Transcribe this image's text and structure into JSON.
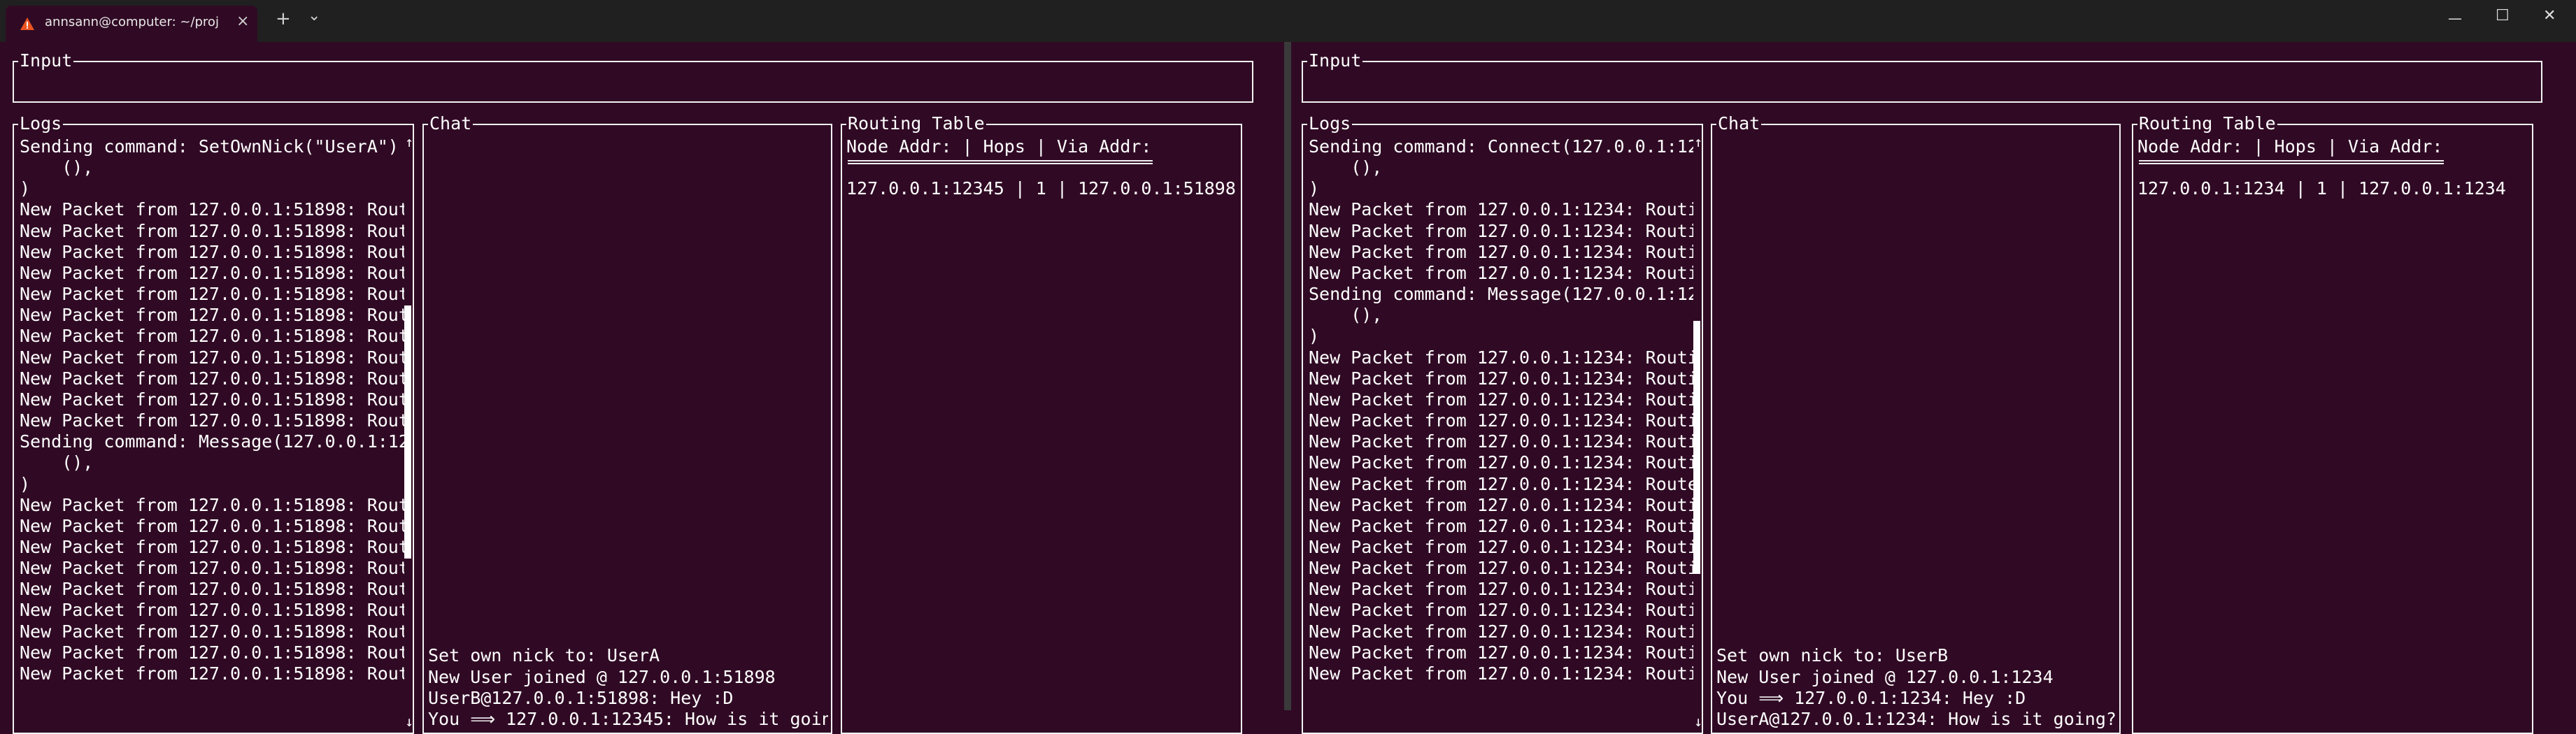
{
  "window": {
    "tab_title": "annsann@computer: ~/project",
    "new_tab_symbol": "+",
    "dropdown_symbol": "⌄",
    "close_symbol": "×",
    "minimize_symbol": "—",
    "maximize_symbol": "☐",
    "window_close_symbol": "✕",
    "accent_color": "#e95420"
  },
  "left": {
    "input_title": "Input",
    "logs_title": "Logs",
    "logs_lines": "Sending command: SetOwnNick(\"UserA\")\n    (),\n)\nNew Packet from 127.0.0.1:51898: Rout\nNew Packet from 127.0.0.1:51898: Rout\nNew Packet from 127.0.0.1:51898: Rout\nNew Packet from 127.0.0.1:51898: Rout\nNew Packet from 127.0.0.1:51898: Rout\nNew Packet from 127.0.0.1:51898: Rout\nNew Packet from 127.0.0.1:51898: Rout\nNew Packet from 127.0.0.1:51898: Rout\nNew Packet from 127.0.0.1:51898: Rout\nNew Packet from 127.0.0.1:51898: Rout\nNew Packet from 127.0.0.1:51898: Rout\nSending command: Message(127.0.0.1:12\n    (),\n)\nNew Packet from 127.0.0.1:51898: Rout\nNew Packet from 127.0.0.1:51898: Rout\nNew Packet from 127.0.0.1:51898: Rout\nNew Packet from 127.0.0.1:51898: Rout\nNew Packet from 127.0.0.1:51898: Rout\nNew Packet from 127.0.0.1:51898: Rout\nNew Packet from 127.0.0.1:51898: Rout\nNew Packet from 127.0.0.1:51898: Rout\nNew Packet from 127.0.0.1:51898: Rout",
    "scroll_position": 0.5,
    "chat_title": "Chat",
    "chat_lines": "Set own nick to: UserA\nNew User joined @ 127.0.0.1:51898\nUserB@127.0.0.1:51898: Hey :D\nYou ⟹ 127.0.0.1:12345: How is it goin",
    "routing_title": "Routing Table",
    "routing_header": "Node Addr: | Hops | Via Addr:",
    "routing_rows": "127.0.0.1:12345 | 1 | 127.0.0.1:51898"
  },
  "right": {
    "input_title": "Input",
    "logs_title": "Logs",
    "logs_lines": "Sending command: Connect(127.0.0.1:12\n    (),\n)\nNew Packet from 127.0.0.1:1234: Routi\nNew Packet from 127.0.0.1:1234: Routi\nNew Packet from 127.0.0.1:1234: Routi\nNew Packet from 127.0.0.1:1234: Routi\nSending command: Message(127.0.0.1:12\n    (),\n)\nNew Packet from 127.0.0.1:1234: Routi\nNew Packet from 127.0.0.1:1234: Routi\nNew Packet from 127.0.0.1:1234: Routi\nNew Packet from 127.0.0.1:1234: Routi\nNew Packet from 127.0.0.1:1234: Routi\nNew Packet from 127.0.0.1:1234: Routi\nNew Packet from 127.0.0.1:1234: Route\nNew Packet from 127.0.0.1:1234: Routi\nNew Packet from 127.0.0.1:1234: Routi\nNew Packet from 127.0.0.1:1234: Routi\nNew Packet from 127.0.0.1:1234: Routi\nNew Packet from 127.0.0.1:1234: Routi\nNew Packet from 127.0.0.1:1234: Routi\nNew Packet from 127.0.0.1:1234: Routi\nNew Packet from 127.0.0.1:1234: Routi\nNew Packet from 127.0.0.1:1234: Routi",
    "scroll_position": 0.55,
    "chat_title": "Chat",
    "chat_lines": "Set own nick to: UserB\nNew User joined @ 127.0.0.1:1234\nYou ⟹ 127.0.0.1:1234: Hey :D\nUserA@127.0.0.1:1234: How is it going?",
    "routing_title": "Routing Table",
    "routing_header": "Node Addr: | Hops | Via Addr:",
    "routing_rows": "127.0.0.1:1234 | 1 | 127.0.0.1:1234"
  },
  "scroll_arrow_up": "↑",
  "scroll_arrow_down": "↓"
}
